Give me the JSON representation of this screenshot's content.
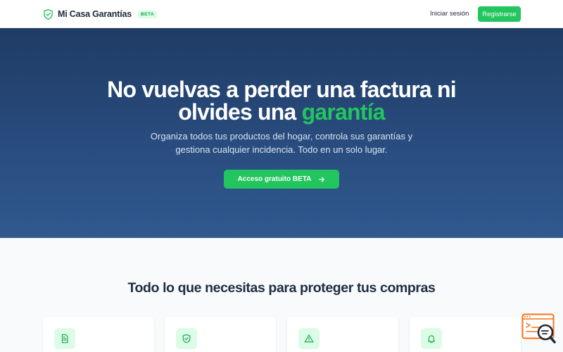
{
  "navbar": {
    "brand_name": "Mi Casa Garantías",
    "badge": "BETA",
    "login_label": "Iniciar sesión",
    "register_label": "Registrarse",
    "brand_icon": "shield-check-icon"
  },
  "hero": {
    "title_part1": "No vuelvas a perder una factura ni olvides una",
    "title_accent": "garantía",
    "subtitle": "Organiza todos tus productos del hogar, controla sus garantías y gestiona cualquier incidencia. Todo en un solo lugar.",
    "cta_label": "Acceso gratuito BETA",
    "cta_icon": "arrow-right-icon"
  },
  "features": {
    "title": "Todo lo que necesitas para proteger tus compras",
    "cards": [
      {
        "icon": "document-icon"
      },
      {
        "icon": "shield-check-icon"
      },
      {
        "icon": "warning-icon"
      },
      {
        "icon": "bell-icon"
      }
    ]
  },
  "colors": {
    "accent": "#22c55e",
    "hero_bg_top": "#1f3c64",
    "hero_bg_bottom": "#30598f",
    "heading": "#1e2d44",
    "widget": "#f97316"
  },
  "help_widget": {
    "icon": "chat-search-icon"
  }
}
